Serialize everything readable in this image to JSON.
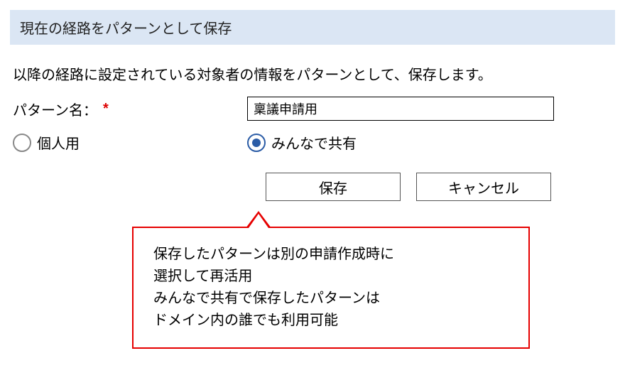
{
  "header": {
    "title": "現在の経路をパターンとして保存"
  },
  "description": "以降の経路に設定されている対象者の情報をパターンとして、保存します。",
  "form": {
    "pattern_name_label": "パターン名：",
    "required_mark": "*",
    "pattern_name_value": "稟議申請用",
    "radio_personal": "個人用",
    "radio_shared": "みんなで共有"
  },
  "buttons": {
    "save": "保存",
    "cancel": "キャンセル"
  },
  "callout": {
    "line1": "保存したパターンは別の申請作成時に",
    "line2": "選択して再活用",
    "line3": "みんなで共有で保存したパターンは",
    "line4": "ドメイン内の誰でも利用可能"
  }
}
